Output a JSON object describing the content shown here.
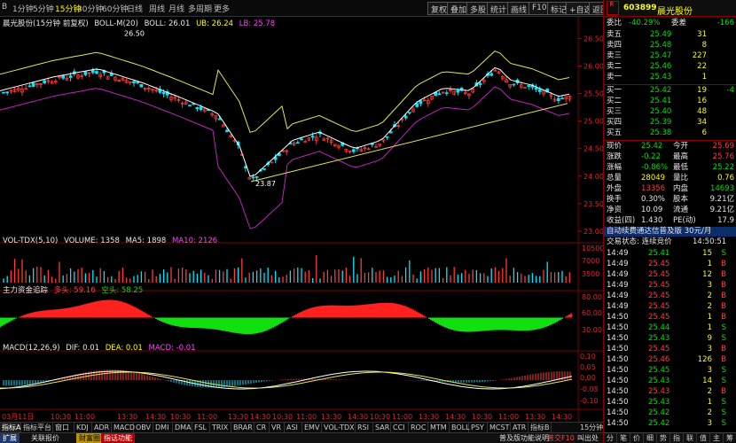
{
  "toolbar": {
    "left_items": [
      "B",
      "1分钟",
      "5分钟",
      "15分钟",
      "30分钟",
      "60分钟",
      "日线",
      "周线",
      "月线",
      "多周期",
      "更多"
    ],
    "active_item": "15分钟",
    "right_buttons": [
      "复权",
      "叠加",
      "多股",
      "统计",
      "画线",
      "F10",
      "标记",
      "+自选",
      "返回"
    ]
  },
  "main_chart": {
    "header_name": "晨光股份(15分钟 前复权)",
    "indicator": "BOLL-M(20)",
    "boll": "BOLL: 26.01",
    "ub": "UB: 26.24",
    "lb": "LB: 25.78",
    "high_mark": "26.50",
    "low_mark": "23.87",
    "price_ticks": [
      "26.50",
      "26.00",
      "25.50",
      "25.00",
      "24.50",
      "24.00",
      "23.50",
      "23.00"
    ],
    "last_price_marker": "25.42"
  },
  "volume_chart": {
    "header": "VOL-TDX(5,10)",
    "volume": "VOLUME: 1358",
    "ma5": "MA5: 1898",
    "ma10": "MA10: 2126",
    "ticks": [
      "10500",
      "7000",
      "3500"
    ]
  },
  "fund_chart": {
    "header": "主力资金追踪",
    "long_label": "多头: 59.16",
    "short_label": "空头: 58.25",
    "ticks": [
      "80.00",
      "60.00",
      "30.00"
    ]
  },
  "macd_chart": {
    "header": "MACD(12,26,9)",
    "dif": "DIF: 0.01",
    "dea": "DEA: 0.01",
    "macd": "MACD: -0.01",
    "ticks": [
      "0.10",
      "0.05",
      "0.00",
      "-0.05",
      "-0.10"
    ]
  },
  "time_axis": [
    "03月11日",
    "10:30",
    "11:00",
    "13:30",
    "14:30",
    "10:30",
    "11:00",
    "13:30",
    "14:30",
    "10:30",
    "11:00",
    "13:30",
    "14:30",
    "10:30",
    "11:00",
    "13:30",
    "14:30",
    "10:30",
    "11:00",
    "13:30",
    "14:30"
  ],
  "indicator_tabs": [
    "指标A",
    "指标平台",
    "窗口",
    "KDJ",
    "ADR",
    "MACD",
    "OBV",
    "DMI",
    "DMA",
    "FSL",
    "TRIX",
    "BRAR",
    "CR",
    "VR",
    "ASI",
    "EMV",
    "VOL-TDX",
    "RSI",
    "SAR",
    "CCI",
    "ROC",
    "MTM",
    "BOLL",
    "PSY",
    "MCST",
    "ATR",
    "指标B"
  ],
  "period_label": "15分钟",
  "status_bar": {
    "expand": "扩展",
    "related": "关联报价",
    "item1": "财富圈",
    "item2": "指话功能",
    "right_text": "普及版功能说明",
    "right_text2": "普交F10",
    "right_text3": "叫出处"
  },
  "quote_panel": {
    "code": "603899",
    "name": "晨光股份",
    "weibi_label": "委比",
    "weibi_value": "-40.29%",
    "weicha_label": "委差",
    "weicha_value": "-166",
    "asks": [
      {
        "label": "卖五",
        "price": "25.49",
        "vol": "31",
        "chg": ""
      },
      {
        "label": "卖四",
        "price": "25.48",
        "vol": "8",
        "chg": ""
      },
      {
        "label": "卖三",
        "price": "25.47",
        "vol": "227",
        "chg": ""
      },
      {
        "label": "卖二",
        "price": "25.46",
        "vol": "22",
        "chg": ""
      },
      {
        "label": "卖一",
        "price": "25.43",
        "vol": "1",
        "chg": ""
      }
    ],
    "bids": [
      {
        "label": "买一",
        "price": "25.42",
        "vol": "19",
        "chg": "-4"
      },
      {
        "label": "买二",
        "price": "25.41",
        "vol": "16",
        "chg": ""
      },
      {
        "label": "买三",
        "price": "25.40",
        "vol": "48",
        "chg": ""
      },
      {
        "label": "买四",
        "price": "25.39",
        "vol": "34",
        "chg": ""
      },
      {
        "label": "买五",
        "price": "25.38",
        "vol": "6",
        "chg": ""
      }
    ],
    "stats": [
      {
        "l1": "现价",
        "v1": "25.42",
        "l2": "今开",
        "v2": "25.69",
        "c1": "green",
        "c2": "red"
      },
      {
        "l1": "涨跌",
        "v1": "-0.22",
        "l2": "最高",
        "v2": "25.76",
        "c1": "green",
        "c2": "red"
      },
      {
        "l1": "涨幅",
        "v1": "-0.86%",
        "l2": "最低",
        "v2": "25.22",
        "c1": "green",
        "c2": "green"
      },
      {
        "l1": "总量",
        "v1": "28049",
        "l2": "量比",
        "v2": "0.76",
        "c1": "yellow",
        "c2": "yellow"
      },
      {
        "l1": "外盘",
        "v1": "13356",
        "l2": "内盘",
        "v2": "14693",
        "c1": "red",
        "c2": "green"
      },
      {
        "l1": "换手",
        "v1": "0.30%",
        "l2": "股本",
        "v2": "9.21亿",
        "c1": "white",
        "c2": "white"
      },
      {
        "l1": "净资",
        "v1": "10.09",
        "l2": "流通",
        "v2": "9.21亿",
        "c1": "white",
        "c2": "white"
      },
      {
        "l1": "收益(四)",
        "v1": "1.430",
        "l2": "PE(动)",
        "v2": "17.9",
        "c1": "white",
        "c2": "white"
      }
    ],
    "promo": "自动续费通达信普及版 30元/月",
    "trade_status_label": "交易状态: 连续竞价",
    "trade_status_time": "14:50:51",
    "ticks": [
      {
        "time": "14:49",
        "price": "25.41",
        "vol": "15",
        "dir": "S"
      },
      {
        "time": "14:49",
        "price": "25.45",
        "vol": "1",
        "dir": "B"
      },
      {
        "time": "14:49",
        "price": "25.45",
        "vol": "12",
        "dir": "B"
      },
      {
        "time": "14:49",
        "price": "25.45",
        "vol": "3",
        "dir": "B"
      },
      {
        "time": "14:49",
        "price": "25.45",
        "vol": "2",
        "dir": "B"
      },
      {
        "time": "14:49",
        "price": "25.45",
        "vol": "2",
        "dir": "B"
      },
      {
        "time": "14:50",
        "price": "25.45",
        "vol": "1",
        "dir": "B"
      },
      {
        "time": "14:50",
        "price": "25.44",
        "vol": "1",
        "dir": "S"
      },
      {
        "time": "14:50",
        "price": "25.43",
        "vol": "9",
        "dir": "S"
      },
      {
        "time": "14:50",
        "price": "25.45",
        "vol": "3",
        "dir": "B"
      },
      {
        "time": "14:50",
        "price": "25.46",
        "vol": "126",
        "dir": "B"
      },
      {
        "time": "14:50",
        "price": "25.45",
        "vol": "3",
        "dir": "S"
      },
      {
        "time": "14:50",
        "price": "25.43",
        "vol": "14",
        "dir": "S"
      },
      {
        "time": "14:50",
        "price": "25.43",
        "vol": "2",
        "dir": "B"
      },
      {
        "time": "14:50",
        "price": "25.43",
        "vol": "1",
        "dir": "S"
      },
      {
        "time": "14:50",
        "price": "25.42",
        "vol": "2",
        "dir": "S"
      },
      {
        "time": "14:50",
        "price": "25.42",
        "vol": "3",
        "dir": "S"
      }
    ],
    "bottom_tabs": [
      "分",
      "笔",
      "价",
      "细",
      "势",
      "指",
      "联",
      "值",
      "主",
      "筹"
    ]
  },
  "colors": {
    "up": "#ff3b3b",
    "down": "#00e000",
    "text_yellow": "#ffff00",
    "accent_red_border": "#8a0000"
  }
}
